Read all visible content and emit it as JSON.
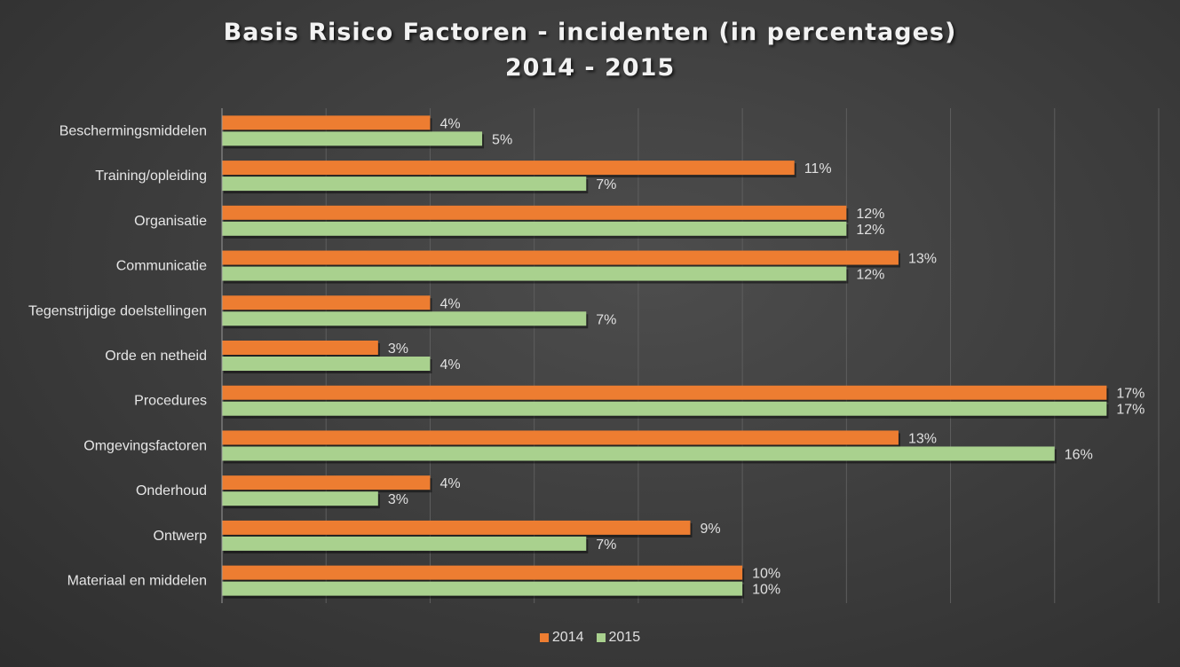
{
  "chart_data": {
    "type": "bar",
    "orientation": "horizontal",
    "title": "Basis Risico Factoren - incidenten (in percentages)",
    "subtitle": "2014 - 2015",
    "xlabel": "",
    "ylabel": "",
    "xlim": [
      0,
      18
    ],
    "grid": true,
    "legend_position": "bottom",
    "categories": [
      "Beschermingsmiddelen",
      "Training/opleiding",
      "Organisatie",
      "Communicatie",
      "Tegenstrijdige doelstellingen",
      "Orde en netheid",
      "Procedures",
      "Omgevingsfactoren",
      "Onderhoud",
      "Ontwerp",
      "Materiaal en middelen"
    ],
    "series": [
      {
        "name": "2014",
        "color": "#ed7d31",
        "values": [
          4,
          11,
          12,
          13,
          4,
          3,
          17,
          13,
          4,
          9,
          10
        ]
      },
      {
        "name": "2015",
        "color": "#a9d18e",
        "values": [
          5,
          7,
          12,
          12,
          7,
          4,
          17,
          16,
          3,
          7,
          10
        ]
      }
    ],
    "value_suffix": "%"
  }
}
